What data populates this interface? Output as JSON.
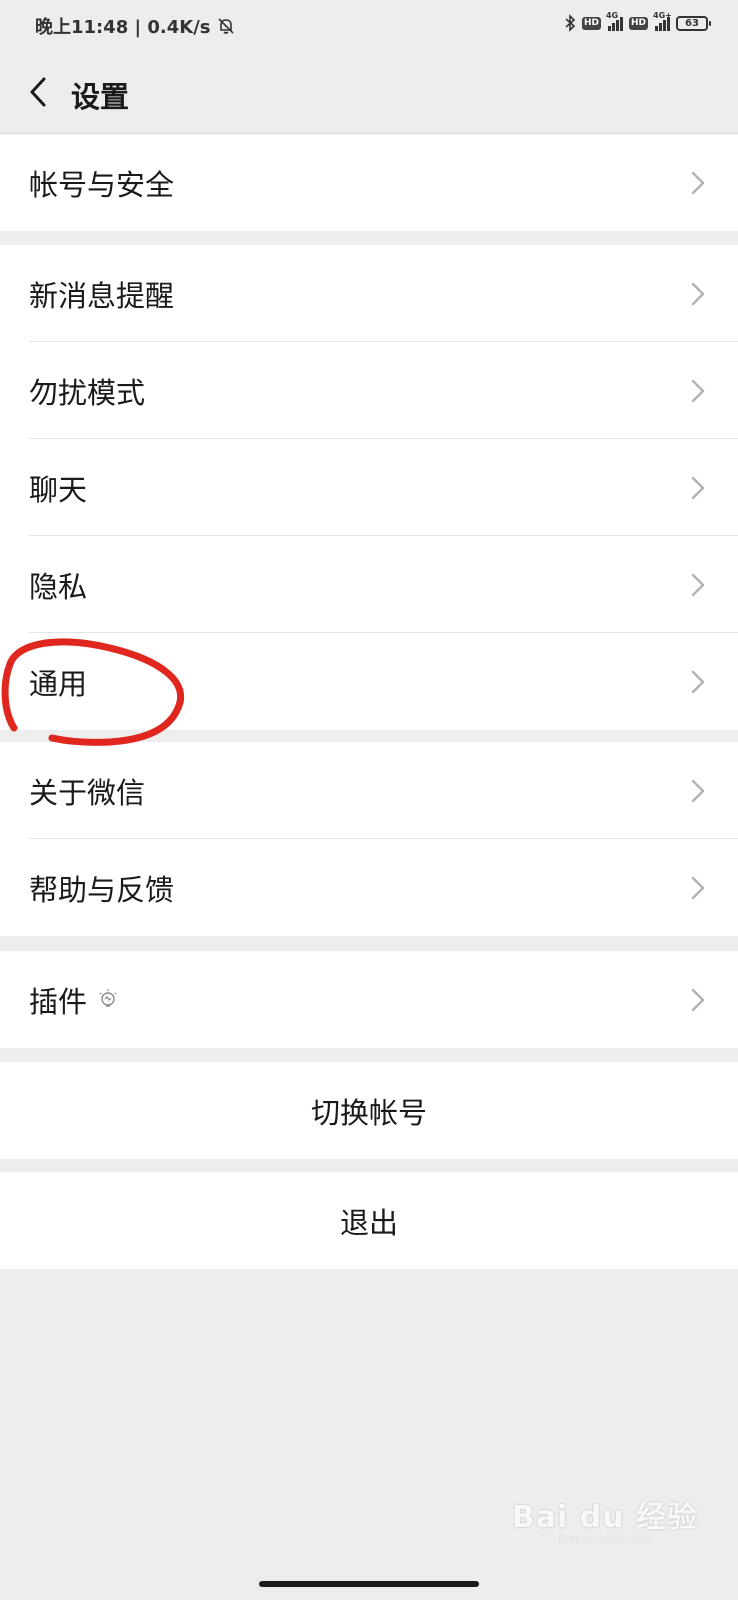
{
  "status_bar": {
    "time_text": "晚上11:48 | 0.4K/s",
    "battery": "63",
    "network_label_1": "4G",
    "network_label_2": "4G+",
    "hd_label": "HD"
  },
  "header": {
    "title": "设置"
  },
  "groups": [
    {
      "items": [
        {
          "label": "帐号与安全"
        }
      ]
    },
    {
      "items": [
        {
          "label": "新消息提醒"
        },
        {
          "label": "勿扰模式"
        },
        {
          "label": "聊天"
        },
        {
          "label": "隐私"
        },
        {
          "label": "通用"
        }
      ]
    },
    {
      "items": [
        {
          "label": "关于微信"
        },
        {
          "label": "帮助与反馈"
        }
      ]
    },
    {
      "items": [
        {
          "label": "插件"
        }
      ]
    }
  ],
  "actions": {
    "switch_account": "切换帐号",
    "logout": "退出"
  },
  "annotation": {
    "color": "#e0271f",
    "circled_item": "通用"
  },
  "watermark": {
    "text": "Bai du 经验",
    "sub": "jingyan.baidu.com"
  },
  "colors": {
    "background": "#ededed",
    "card": "#ffffff",
    "text": "#1a1a1a",
    "chevron": "#b2b2b2"
  }
}
